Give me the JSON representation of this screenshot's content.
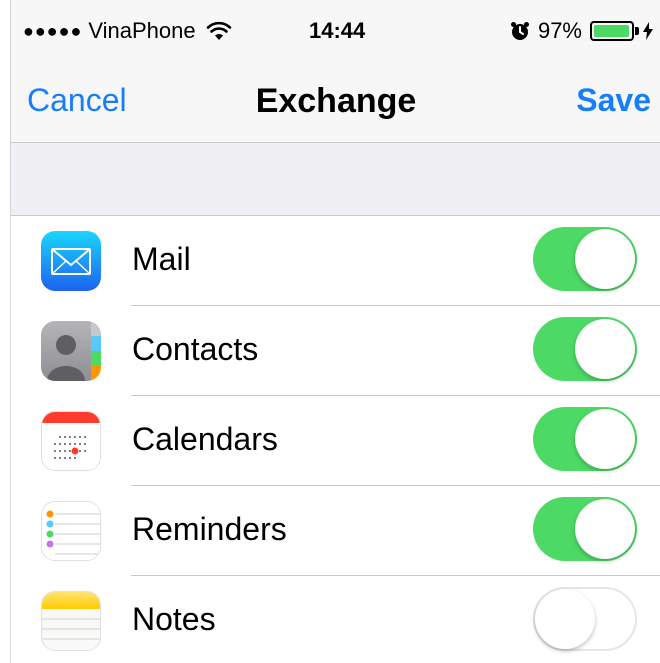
{
  "status_bar": {
    "signal_dots": "●●●●●",
    "carrier": "VinaPhone",
    "time": "14:44",
    "battery_percent": "97%",
    "battery_level": 0.97
  },
  "nav": {
    "cancel_label": "Cancel",
    "title": "Exchange",
    "save_label": "Save"
  },
  "items": [
    {
      "label": "Mail",
      "icon": "mail-icon",
      "enabled": true
    },
    {
      "label": "Contacts",
      "icon": "contacts-icon",
      "enabled": true
    },
    {
      "label": "Calendars",
      "icon": "calendar-icon",
      "enabled": true
    },
    {
      "label": "Reminders",
      "icon": "reminders-icon",
      "enabled": true
    },
    {
      "label": "Notes",
      "icon": "notes-icon",
      "enabled": false
    }
  ],
  "colors": {
    "accent": "#157efb",
    "toggle_on": "#4cd964",
    "group_background": "#efeff4"
  }
}
